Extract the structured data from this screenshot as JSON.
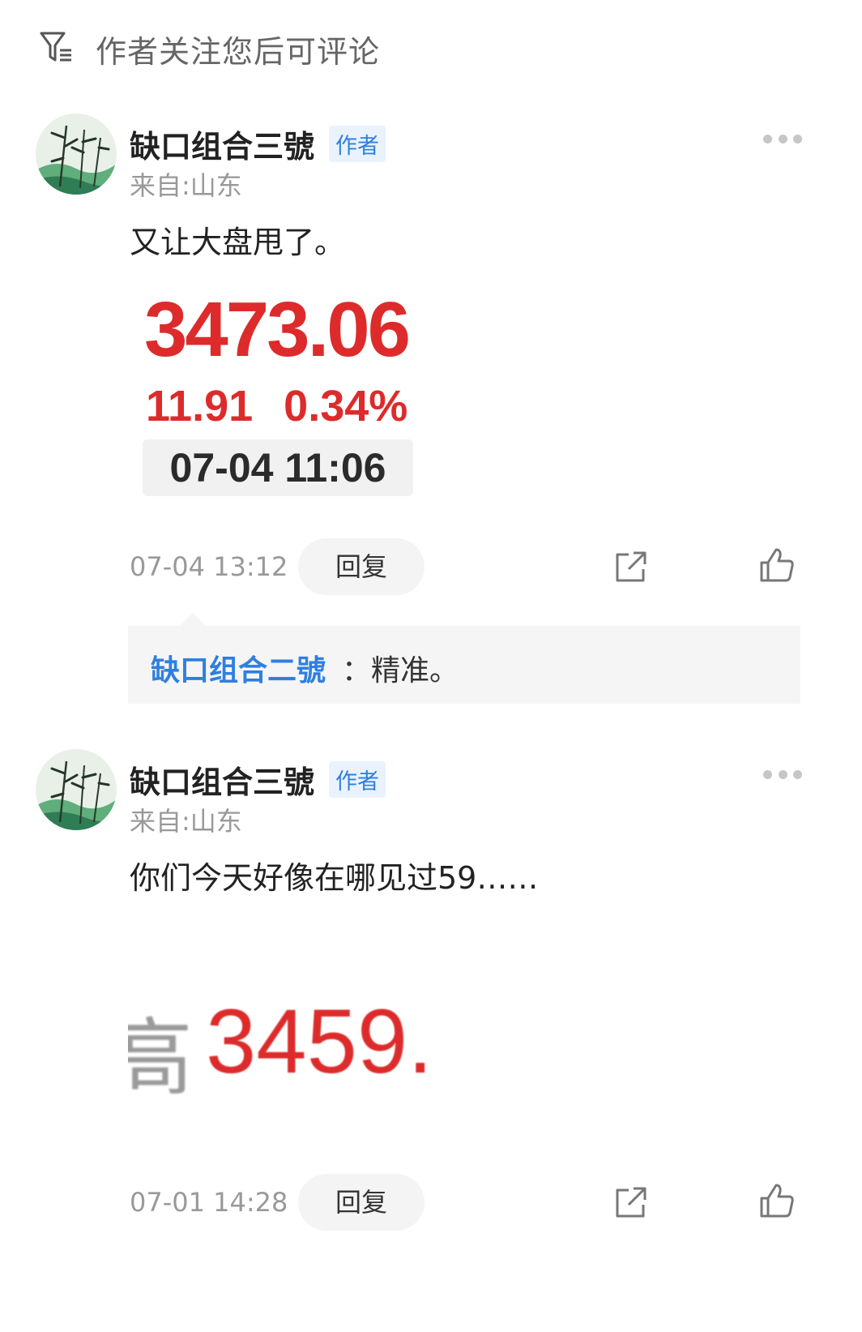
{
  "filter": {
    "label": "作者关注您后可评论",
    "icon": "filter-icon"
  },
  "comments": [
    {
      "author": "缺口组合三號",
      "badge": "作者",
      "location": "来自:山东",
      "text": "又让大盘甩了。",
      "image": {
        "price": "3473.06",
        "change": "11.91",
        "change_pct": "0.34%",
        "time": "07-04 11:06"
      },
      "timestamp": "07-04 13:12",
      "reply_label": "回复",
      "replies": [
        {
          "name": "缺口组合二號",
          "text": "：精准。"
        }
      ]
    },
    {
      "author": "缺口组合三號",
      "badge": "作者",
      "location": "来自:山东",
      "text": "你们今天好像在哪见过59……",
      "image": {
        "prefix": "高",
        "value": "3459."
      },
      "timestamp": "07-01 14:28",
      "reply_label": "回复"
    }
  ],
  "colors": {
    "accent_blue": "#2f7fe0",
    "price_red": "#dd2b2b",
    "muted_gray": "#999999"
  }
}
